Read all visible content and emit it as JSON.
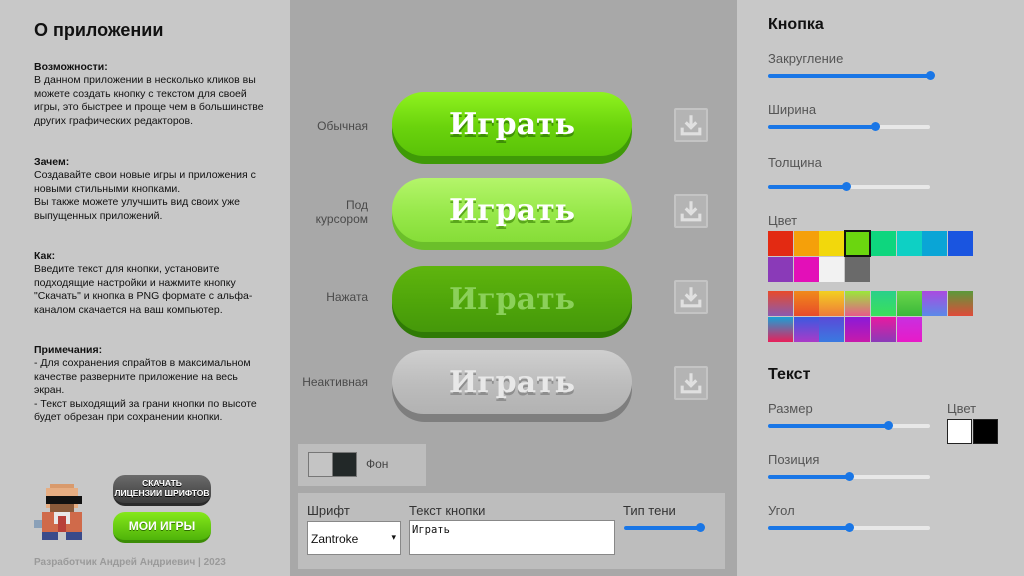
{
  "about": {
    "title": "О приложении",
    "features_h": "Возможности:",
    "features": "В данном приложении в несколько кликов вы можете создать кнопку с текстом для своей игры, это быстрее и проще чем в большинстве других графических редакторов.",
    "why_h": "Зачем:",
    "why": "Создавайте свои новые игры и приложения с новыми стильными кнопками.",
    "why2": "Вы также можете улучшить вид своих уже выпущенных приложений.",
    "how_h": "Как:",
    "how": "Введите текст для кнопки, установите подходящие настройки и нажмите кнопку \"Скачать\" и кнопка в PNG формате с альфа-каналом скачается на ваш компьютер.",
    "notes_h": "Примечания:",
    "note1": "- Для сохранения спрайтов в максимальном качестве разверните приложение на весь экран.",
    "note2": "- Текст выходящий за грани кнопки по высоте будет обрезан при сохранении кнопки.",
    "license_line1": "СКАЧАТЬ",
    "license_line2": "ЛИЦЕНЗИИ ШРИФТОВ",
    "my_games": "МОИ ИГРЫ",
    "footer": "Разработчик Андрей Андриевич | 2023"
  },
  "preview": {
    "button_text": "Играть",
    "states": [
      "Обычная",
      "Под курсором",
      "Нажата",
      "Неактивная"
    ],
    "state_lines": [
      [
        "Обычная"
      ],
      [
        "Под",
        "курсором"
      ],
      [
        "Нажата"
      ],
      [
        "Неактивная"
      ]
    ],
    "background_label": "Фон",
    "bg_colors": [
      "#c4c4c4",
      "#222828"
    ]
  },
  "settings": {
    "font_label": "Шрифт",
    "font_value": "Zantroke",
    "text_label": "Текст кнопки",
    "text_value": "Играть",
    "shadow_label": "Тип тени",
    "shadow_value": 0.95
  },
  "button_panel": {
    "title": "Кнопка",
    "rounding_label": "Закругление",
    "rounding_value": 1.0,
    "width_label": "Ширина",
    "width_value": 0.66,
    "thickness_label": "Толщина",
    "thickness_value": 0.48,
    "color_label": "Цвет",
    "solid_colors": [
      "#e32a12",
      "#f5a00a",
      "#f2d80c",
      "#6bd60f",
      "#0ed67e",
      "#0ed0c4",
      "#0aa5d6",
      "#1a55e0",
      "#8a3ab8",
      "#e30fb8",
      "#f2f2f2",
      "#6a6a6a"
    ],
    "selected_color": "#6bd60f",
    "gradients": [
      [
        "#e84a2a",
        "#8a5ab0"
      ],
      [
        "#f08a1a",
        "#e84a2a"
      ],
      [
        "#f2d020",
        "#f07a3a"
      ],
      [
        "#9ae83a",
        "#e85a8a"
      ],
      [
        "#2ad08a",
        "#3ae05a"
      ],
      [
        "#6ad64a",
        "#3ab83a"
      ],
      [
        "#aa4ae0",
        "#5a8ae8"
      ],
      [
        "#5a9a3a",
        "#e04a3a"
      ],
      [
        "#1aa0d6",
        "#e8205a"
      ],
      [
        "#3a5ae0",
        "#aa3ac8"
      ],
      [
        "#5a4ad8",
        "#3a7ae0"
      ],
      [
        "#8a1ad8",
        "#c81aaa"
      ],
      [
        "#e81aa0",
        "#8a3ab8"
      ],
      [
        "#c830e0",
        "#e81ac8"
      ]
    ]
  },
  "text_panel": {
    "title": "Текст",
    "size_label": "Размер",
    "size_value": 0.74,
    "color_label": "Цвет",
    "text_colors": [
      "#ffffff",
      "#000000"
    ],
    "position_label": "Позиция",
    "position_value": 0.5,
    "angle_label": "Угол",
    "angle_value": 0.5
  }
}
